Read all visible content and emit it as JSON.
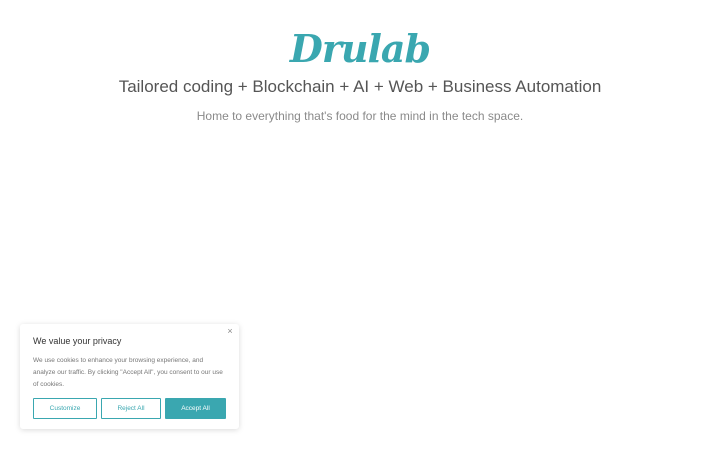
{
  "colors": {
    "accent": "#3aa7b0"
  },
  "hero": {
    "logo": "Drulab",
    "headline": "Tailored coding + Blockchain + AI + Web + Business Automation",
    "tagline": "Home to everything that's food for the mind in the tech space."
  },
  "cookie_banner": {
    "close_icon": "close-icon",
    "close_glyph": "×",
    "title": "We value your privacy",
    "text": "We use cookies to enhance your browsing experience, and analyze our traffic. By clicking \"Accept All\", you consent to our use of cookies.",
    "customize_label": "Customize",
    "reject_label": "Reject All",
    "accept_label": "Accept All"
  }
}
